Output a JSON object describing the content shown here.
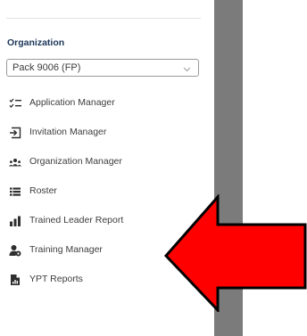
{
  "sidebar": {
    "organization": {
      "heading": "Organization",
      "selected": "Pack 9006 (FP)"
    },
    "items": [
      {
        "label": "Application Manager",
        "icon": "checklist-icon"
      },
      {
        "label": "Invitation Manager",
        "icon": "sign-in-icon"
      },
      {
        "label": "Organization Manager",
        "icon": "users-icon"
      },
      {
        "label": "Roster",
        "icon": "list-icon"
      },
      {
        "label": "Trained Leader Report",
        "icon": "bar-chart-icon"
      },
      {
        "label": "Training Manager",
        "icon": "user-gear-icon"
      },
      {
        "label": "YPT Reports",
        "icon": "file-chart-icon"
      }
    ]
  },
  "colors": {
    "heading": "#1a3558",
    "text": "#3d3d3d",
    "icon": "#2f2f2f",
    "band": "#7b7b7b",
    "arrow_fill": "#ff0000",
    "arrow_stroke": "#000000"
  }
}
